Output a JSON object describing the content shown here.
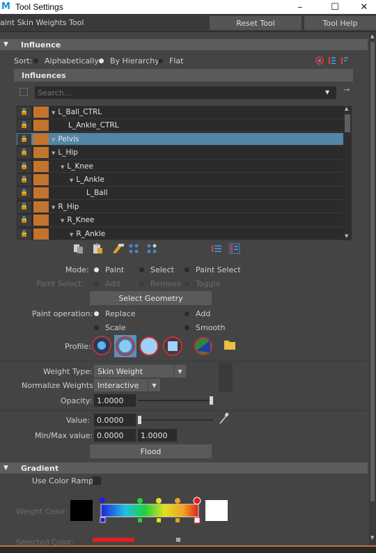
{
  "window": {
    "app_icon": "M",
    "title": "Tool Settings",
    "minimize": "–",
    "maximize": "☐",
    "close": "✕"
  },
  "header": {
    "tool_name": "aint Skin Weights Tool",
    "reset_label": "Reset Tool",
    "help_label": "Tool Help"
  },
  "influence": {
    "section_label": "Influence",
    "sort_label": "Sort:",
    "sort_options": [
      "Alphabetically",
      "By Hierarchy",
      "Flat"
    ],
    "sort_selected": "By Hierarchy",
    "influences_label": "Influences",
    "search_placeholder": "Search...",
    "tree": [
      {
        "label": "L_Ball_CTRL",
        "indent": 0,
        "expanded": true,
        "locked": true,
        "selected": false
      },
      {
        "label": "L_Ankle_CTRL",
        "indent": 1,
        "expanded": false,
        "locked": true,
        "selected": false
      },
      {
        "label": "Pelvis",
        "indent": 0,
        "expanded": true,
        "locked": true,
        "selected": true
      },
      {
        "label": "L_Hip",
        "indent": 0,
        "expanded": true,
        "locked": false,
        "selected": false
      },
      {
        "label": "L_Knee",
        "indent": 1,
        "expanded": true,
        "locked": false,
        "selected": false
      },
      {
        "label": "L_Ankle",
        "indent": 2,
        "expanded": true,
        "locked": true,
        "selected": false
      },
      {
        "label": "L_Ball",
        "indent": 3,
        "expanded": false,
        "locked": true,
        "selected": false
      },
      {
        "label": "R_Hip",
        "indent": 0,
        "expanded": true,
        "locked": true,
        "selected": false
      },
      {
        "label": "R_Knee",
        "indent": 1,
        "expanded": true,
        "locked": true,
        "selected": false
      },
      {
        "label": "R_Ankle",
        "indent": 2,
        "expanded": true,
        "locked": true,
        "selected": false
      }
    ]
  },
  "mode": {
    "label": "Mode:",
    "options": [
      "Paint",
      "Select",
      "Paint Select"
    ],
    "selected": "Paint"
  },
  "paint_select": {
    "label": "Paint Select:",
    "options": [
      "Add",
      "Remove",
      "Toggle"
    ]
  },
  "select_geometry_label": "Select Geometry",
  "paint_operation": {
    "label": "Paint operation:",
    "options": [
      "Replace",
      "Add",
      "Scale",
      "Smooth"
    ],
    "selected": "Replace"
  },
  "profile_label": "Profile:",
  "weight_type": {
    "label": "Weight Type:",
    "value": "Skin Weight"
  },
  "normalize": {
    "label": "Normalize Weights:",
    "value": "Interactive"
  },
  "opacity": {
    "label": "Opacity:",
    "value": "1.0000",
    "level": 1.0
  },
  "value": {
    "label": "Value:",
    "value": "0.0000",
    "level": 0.0
  },
  "minmax": {
    "label": "Min/Max value:",
    "min": "0.0000",
    "max": "1.0000"
  },
  "flood_label": "Flood",
  "gradient": {
    "section_label": "Gradient",
    "use_color_ramp_label": "Use Color Ramp",
    "weight_color_label": "Weight Color:",
    "selected_color_label": "Selected Color:"
  },
  "colors": {
    "accent": "#5285a6",
    "joint_swatch": "#c2742c",
    "lock": "#e0a020"
  }
}
